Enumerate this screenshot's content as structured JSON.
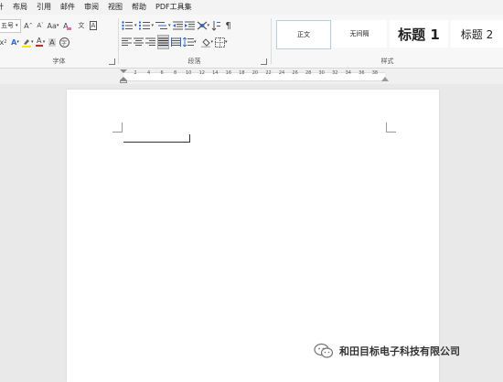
{
  "menu": {
    "items": [
      "计",
      "布局",
      "引用",
      "邮件",
      "审阅",
      "视图",
      "帮助",
      "PDF工具集"
    ]
  },
  "ribbon": {
    "font_group": {
      "font_size_value": "五号",
      "label": "字体",
      "grow_font_label": "A",
      "shrink_font_label": "A",
      "change_case_label": "Aa",
      "clear_format_label": "A",
      "phonetic_label": "文",
      "border_char_label": "A",
      "subscript_label": "x",
      "text_effect_label": "A",
      "font_color_label": "A",
      "char_shading_label": "A",
      "enclose_char_label": "字",
      "highlight_color": "#ffe600",
      "font_color": "#e02020"
    },
    "paragraph_group": {
      "label": "段落"
    },
    "styles_group": {
      "label": "样式",
      "items": [
        "正文",
        "无间隔",
        "标题 1",
        "标题 2"
      ]
    }
  },
  "ruler": {
    "ticks": [
      "2",
      "4",
      "6",
      "8",
      "10",
      "12",
      "14",
      "16",
      "18",
      "20",
      "22",
      "24",
      "26",
      "28",
      "30",
      "32",
      "34",
      "36",
      "38"
    ]
  },
  "watermark": {
    "text": "和田目标电子科技有限公司",
    "icon": "wechat-icon"
  }
}
